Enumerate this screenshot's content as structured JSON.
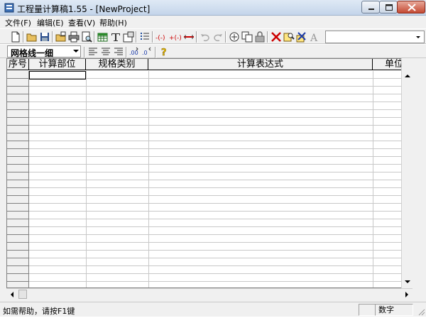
{
  "window": {
    "title": "工程量计算稿1.55 - [NewProject]",
    "controls": [
      "minimize",
      "maximize",
      "close"
    ]
  },
  "menu": {
    "items": [
      "文件(F)",
      "编辑(E)",
      "查看(V)",
      "帮助(H)"
    ]
  },
  "toolbar": {
    "icons": [
      "new-file-icon",
      "open-folder-icon",
      "save-icon",
      "open-project-icon",
      "print-icon",
      "print-preview-icon",
      "insert-table-icon",
      "text-format-icon",
      "properties-icon",
      "list-icon",
      "parentheses-minus-icon",
      "parentheses-plus-icon",
      "bracket-insert-icon",
      "undo-icon",
      "redo-icon",
      "view-icon",
      "copy-icon",
      "lock-icon",
      "delete-icon",
      "find-icon",
      "replace-icon",
      "font-icon"
    ],
    "combo_value": ""
  },
  "format_toolbar": {
    "gridline_selected": "网格线一细",
    "icons": [
      "align-left-icon",
      "align-center-icon",
      "align-right-icon",
      "decimal-increase-icon",
      "decimal-decrease-icon",
      "help-icon"
    ]
  },
  "grid": {
    "columns": [
      "序号",
      "计算部位",
      "规格类别",
      "计算表达式",
      "单位"
    ],
    "rows": []
  },
  "status": {
    "help_text": "如需帮助，请按F1键",
    "panel_1": "",
    "panel_2": "数字"
  },
  "colors": {
    "delete_icon": "#cc0000",
    "help_icon": "#e8c000",
    "grid_line": "#c8c8c8"
  }
}
